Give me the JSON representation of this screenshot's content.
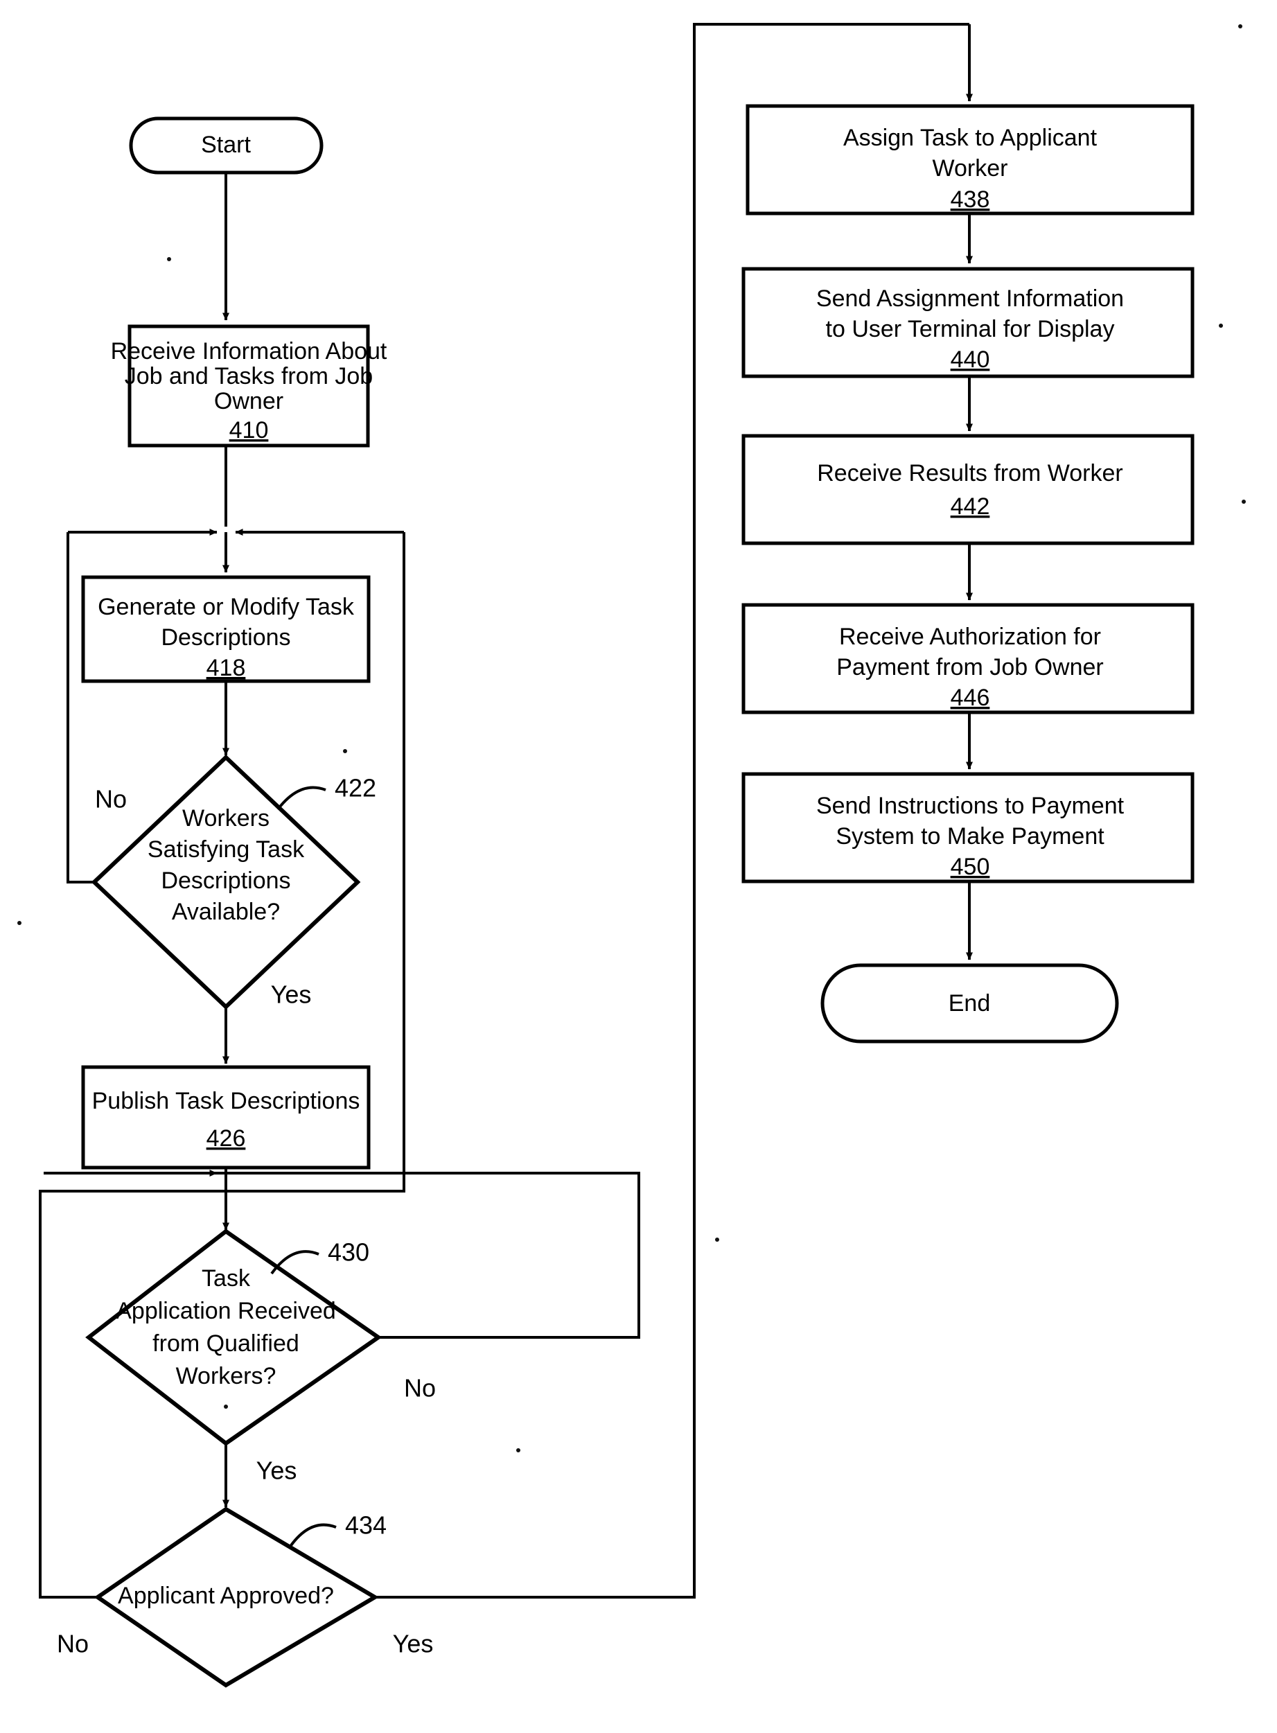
{
  "figure": {
    "kind": "patent-flowchart",
    "background": "#ffffff",
    "ink": "#000000"
  },
  "terminators": {
    "start": {
      "label": "Start"
    },
    "end": {
      "label": "End"
    }
  },
  "process_boxes": [
    {
      "id": "b410",
      "lines": [
        "Receive Information About",
        "Job and Tasks from Job",
        "Owner"
      ],
      "ref": "410"
    },
    {
      "id": "b418",
      "lines": [
        "Generate or Modify Task",
        "Descriptions"
      ],
      "ref": "418"
    },
    {
      "id": "b426",
      "lines": [
        "Publish Task Descriptions"
      ],
      "ref": "426"
    },
    {
      "id": "b438",
      "lines": [
        "Assign Task to Applicant",
        "Worker"
      ],
      "ref": "438"
    },
    {
      "id": "b440",
      "lines": [
        "Send Assignment Information",
        "to User Terminal for Display"
      ],
      "ref": "440"
    },
    {
      "id": "b442",
      "lines": [
        "Receive Results from Worker"
      ],
      "ref": "442"
    },
    {
      "id": "b446",
      "lines": [
        "Receive Authorization for",
        "Payment from Job Owner"
      ],
      "ref": "446"
    },
    {
      "id": "b450",
      "lines": [
        "Send Instructions to Payment",
        "System to Make Payment"
      ],
      "ref": "450"
    }
  ],
  "decisions": [
    {
      "id": "d422",
      "lines": [
        "Workers",
        "Satisfying Task",
        "Descriptions",
        "Available?"
      ],
      "ref": "422",
      "yes_label": "Yes",
      "no_label": "No"
    },
    {
      "id": "d430",
      "lines": [
        "Task",
        "Application Received",
        "from Qualified",
        "Workers?"
      ],
      "ref": "430",
      "yes_label": "Yes",
      "no_label": "No"
    },
    {
      "id": "d434",
      "lines": [
        "Applicant Approved?"
      ],
      "ref": "434",
      "yes_label": "Yes",
      "no_label": "No"
    }
  ],
  "branch_labels": {
    "d422_no": "No",
    "d422_yes": "Yes",
    "d430_no": "No",
    "d430_yes": "Yes",
    "d434_no": "No",
    "d434_yes": "Yes"
  },
  "reference_numerals": {
    "r410": "410",
    "r418": "418",
    "r422": "422",
    "r426": "426",
    "r430": "430",
    "r434": "434",
    "r438": "438",
    "r440": "440",
    "r442": "442",
    "r446": "446",
    "r450": "450"
  }
}
